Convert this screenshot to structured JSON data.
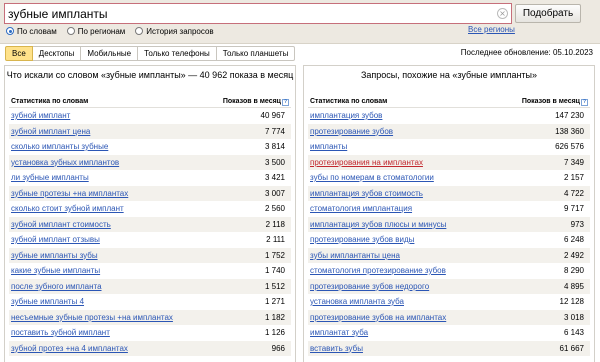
{
  "search": {
    "query": "зубные импланты",
    "button_label": "Подобрать",
    "clear_icon": "close-icon"
  },
  "modes": [
    {
      "label": "По словам",
      "selected": true
    },
    {
      "label": "По регионам",
      "selected": false
    },
    {
      "label": "История запросов",
      "selected": false
    }
  ],
  "regions_link": "Все регионы",
  "tabs": [
    {
      "label": "Все",
      "active": true
    },
    {
      "label": "Десктопы",
      "active": false
    },
    {
      "label": "Мобильные",
      "active": false
    },
    {
      "label": "Только телефоны",
      "active": false
    },
    {
      "label": "Только планшеты",
      "active": false
    }
  ],
  "last_update": "Последнее обновление: 05.10.2023",
  "left": {
    "title": "Что искали со словом «зубные импланты» — 40 962 показа в месяц",
    "col_keyword": "Статистика по словам",
    "col_count": "Показов в месяц",
    "rows": [
      {
        "kw": "зубной имплант",
        "count": "40 967"
      },
      {
        "kw": "зубной имплант цена",
        "count": "7 774"
      },
      {
        "kw": "сколько импланты зубные",
        "count": "3 814"
      },
      {
        "kw": "установка зубных имплантов",
        "count": "3 500"
      },
      {
        "kw": "ли зубные импланты",
        "count": "3 421"
      },
      {
        "kw": "зубные протезы +на имплантах",
        "count": "3 007"
      },
      {
        "kw": "сколько стоит зубной имплант",
        "count": "2 560"
      },
      {
        "kw": "зубной имплант стоимость",
        "count": "2 118"
      },
      {
        "kw": "зубной имплант отзывы",
        "count": "2 111"
      },
      {
        "kw": "зубные импланты зубы",
        "count": "1 752"
      },
      {
        "kw": "какие зубные импланты",
        "count": "1 740"
      },
      {
        "kw": "после зубного импланта",
        "count": "1 512"
      },
      {
        "kw": "зубные импланты 4",
        "count": "1 271"
      },
      {
        "kw": "несъемные зубные протезы +на имплантах",
        "count": "1 182"
      },
      {
        "kw": "поставить зубной имплант",
        "count": "1 126"
      },
      {
        "kw": "зубной протез +на 4 имплантах",
        "count": "966"
      }
    ]
  },
  "right": {
    "title": "Запросы, похожие на «зубные импланты»",
    "col_keyword": "Статистика по словам",
    "col_count": "Показов в месяц",
    "rows": [
      {
        "kw": "имплантация зубов",
        "count": "147 230",
        "red": false
      },
      {
        "kw": "протезирование зубов",
        "count": "138 360",
        "red": false
      },
      {
        "kw": "импланты",
        "count": "626 576",
        "red": false
      },
      {
        "kw": "протезирования на имплантах",
        "count": "7 349",
        "red": true
      },
      {
        "kw": "зубы по номерам в стоматологии",
        "count": "2 157",
        "red": false
      },
      {
        "kw": "имплантация зубов стоимость",
        "count": "4 722",
        "red": false
      },
      {
        "kw": "стоматология имплантация",
        "count": "9 717",
        "red": false
      },
      {
        "kw": "имплантация зубов плюсы и минусы",
        "count": "973",
        "red": false
      },
      {
        "kw": "протезирование зубов виды",
        "count": "6 248",
        "red": false
      },
      {
        "kw": "зубы имплантанты цена",
        "count": "2 492",
        "red": false
      },
      {
        "kw": "стоматология протезирование зубов",
        "count": "8 290",
        "red": false
      },
      {
        "kw": "протезирование зубов недорого",
        "count": "4 895",
        "red": false
      },
      {
        "kw": "установка импланта зуба",
        "count": "12 128",
        "red": false
      },
      {
        "kw": "протезирование зубов на имплантах",
        "count": "3 018",
        "red": false
      },
      {
        "kw": "имплантат зуба",
        "count": "6 143",
        "red": false
      },
      {
        "kw": "вставить зубы",
        "count": "61 667",
        "red": false
      }
    ]
  },
  "colors": {
    "topbar_bg": "#ede9e1",
    "link": "#2b56b5",
    "link_alert": "#c2282e",
    "active_tab": "#ffe28a",
    "search_border": "#c66f7a"
  }
}
